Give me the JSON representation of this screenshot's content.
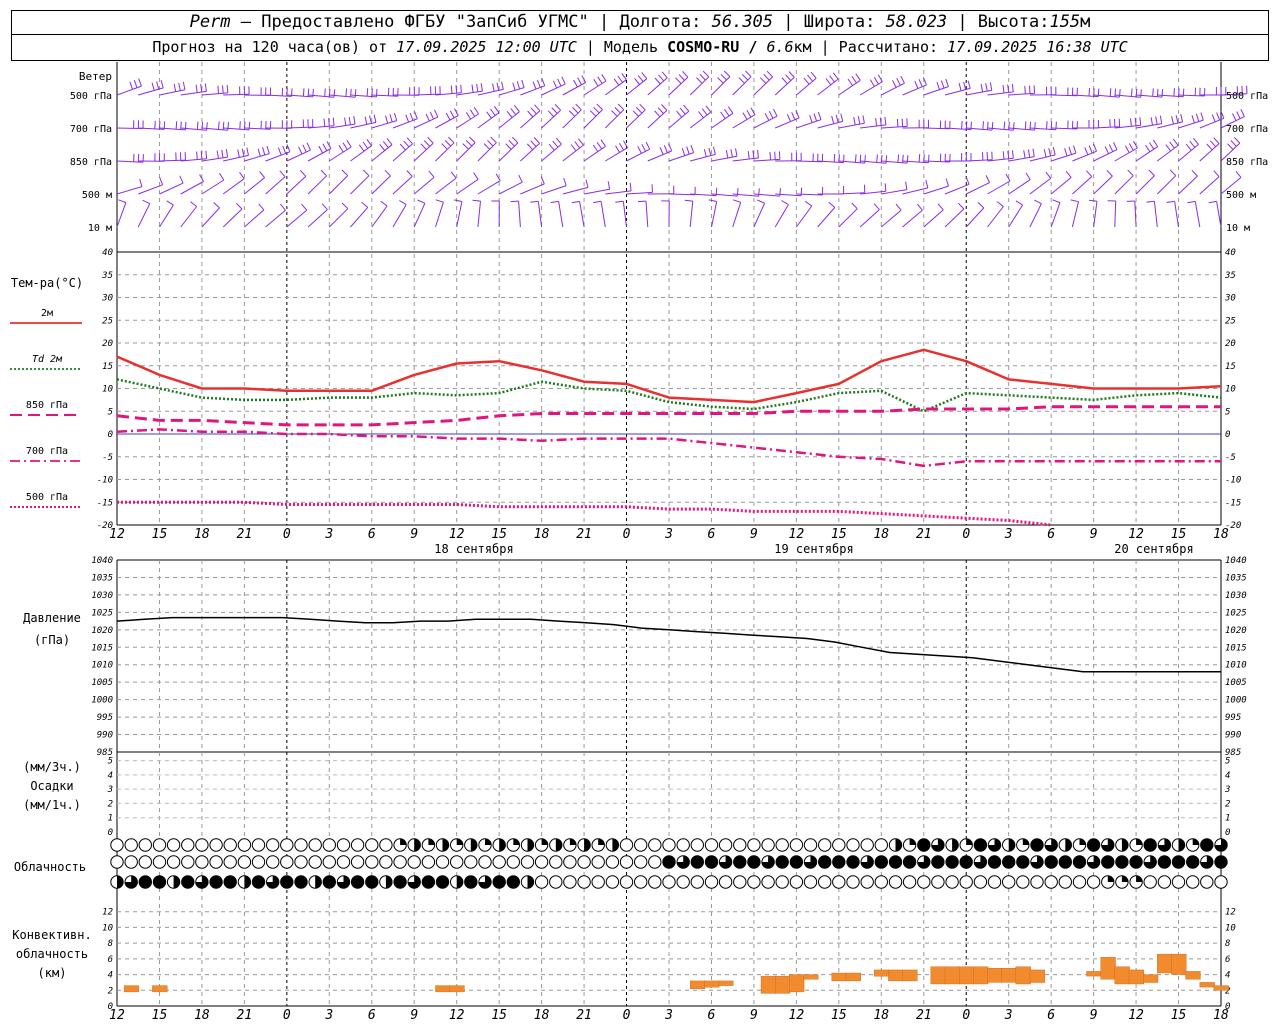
{
  "header": {
    "line1": {
      "station": "Perm",
      "provider": "— Предоставлено ФГБУ \"ЗапСиб УГМС\" | Долгота:",
      "lon": "56.305",
      "lat_label": "| Широта:",
      "lat": "58.023",
      "alt_label": "| Высота:",
      "alt": "155",
      "alt_unit": "м"
    },
    "line2": {
      "prefix": "Прогноз на 120 часа(ов) от",
      "run": "17.09.2025 12:00 UTC",
      "model_label": "| Модель",
      "model": "COSMO-RU /",
      "res": "6.6",
      "res_unit": "км | Рассчитано:",
      "calc": "17.09.2025 16:38 UTC"
    }
  },
  "wind_panel": {
    "title": "Ветер",
    "levels": [
      "500 гПа",
      "700 гПа",
      "850 гПа",
      "500 м",
      "10 м"
    ]
  },
  "temp_panel": {
    "title": "Тем-ра(°C)",
    "legend": [
      {
        "label": "2м",
        "color": "#e8302e",
        "style": "solid"
      },
      {
        "label": "Td 2м",
        "color": "#1f7a1f",
        "style": "dotted"
      },
      {
        "label": "850 гПа",
        "color": "#e0167f",
        "style": "dashed"
      },
      {
        "label": "700 гПа",
        "color": "#e0167f",
        "style": "dashdot"
      },
      {
        "label": "500 гПа",
        "color": "#e0167f",
        "style": "dotted"
      }
    ]
  },
  "press_panel": {
    "title1": "Давление",
    "title2": "(гПа)"
  },
  "precip_panel": {
    "line1": "(мм/3ч.)",
    "line2": "Осадки",
    "line3": "(мм/1ч.)"
  },
  "cloud_panel": {
    "title": "Облачность"
  },
  "conv_panel": {
    "line1": "Конвективн.",
    "line2": "облачность",
    "line3": "(км)"
  },
  "time_labels": [
    "12",
    "15",
    "18",
    "21",
    "0",
    "3",
    "6",
    "9",
    "12",
    "15",
    "18",
    "21",
    "0",
    "3",
    "6",
    "9",
    "12",
    "15",
    "18",
    "21",
    "0",
    "3",
    "6",
    "9",
    "12",
    "15",
    "18"
  ],
  "date_labels": [
    "18 сентября",
    "19 сентября",
    "20 сентября"
  ],
  "colors": {
    "wind": "#8a2be2",
    "t2m": "#e8302e",
    "td": "#1f7a1f",
    "upper": "#e0167f",
    "pressure": "#000000",
    "convective": "#f28a2e",
    "zero_line": "#3b3bd6"
  },
  "chart_data": [
    {
      "type": "line",
      "title": "Тем-ра(°C)",
      "ylim": [
        -20,
        40
      ],
      "yticks": [
        -20,
        -15,
        -10,
        -5,
        0,
        5,
        10,
        15,
        20,
        25,
        30,
        35,
        40
      ],
      "x_hours": [
        0,
        3,
        6,
        9,
        12,
        15,
        18,
        21,
        24,
        27,
        30,
        33,
        36,
        39,
        42,
        45,
        48,
        51,
        54,
        57,
        60,
        63,
        66,
        69,
        72,
        75,
        78
      ],
      "series": [
        {
          "name": "2м",
          "values": [
            17,
            13,
            10,
            10,
            9.5,
            9.5,
            9.5,
            13,
            15.5,
            16,
            14,
            11.5,
            11,
            8,
            7.5,
            7,
            9,
            11,
            16,
            18.5,
            16,
            12,
            11,
            10,
            10,
            10,
            10.5
          ]
        },
        {
          "name": "Td 2м",
          "values": [
            12,
            10,
            8,
            7.5,
            7.5,
            8,
            8,
            9,
            8.5,
            9,
            11.5,
            10,
            9.5,
            7,
            6,
            5.5,
            7,
            9,
            9.5,
            5,
            9,
            8.5,
            8,
            7.5,
            8.5,
            9,
            8
          ]
        },
        {
          "name": "850 гПа",
          "values": [
            4,
            3,
            3,
            2.5,
            2,
            2,
            2,
            2.5,
            3,
            4,
            4.5,
            4.5,
            4.5,
            4.5,
            4.5,
            4.5,
            5,
            5,
            5,
            5.5,
            5.5,
            5.5,
            6,
            6,
            6,
            6,
            6
          ]
        },
        {
          "name": "700 гПа",
          "values": [
            0.5,
            1,
            0.5,
            0.5,
            0,
            0,
            -0.5,
            -0.5,
            -1,
            -1,
            -1.5,
            -1,
            -1,
            -1,
            -2,
            -3,
            -4,
            -5,
            -5.5,
            -7,
            -6,
            -6,
            -6,
            -6,
            -6,
            -6,
            -6
          ]
        },
        {
          "name": "500 гПа",
          "values": [
            -15,
            -15,
            -15,
            -15,
            -15.5,
            -15.5,
            -15.5,
            -15.5,
            -15.5,
            -16,
            -16,
            -16,
            -16,
            -16.5,
            -16.5,
            -17,
            -17,
            -17,
            -17.5,
            -18,
            -18.5,
            -19,
            -20
          ]
        }
      ]
    },
    {
      "type": "line",
      "title": "Давление (гПа)",
      "ylim": [
        985,
        1040
      ],
      "yticks": [
        985,
        990,
        995,
        1000,
        1005,
        1010,
        1015,
        1020,
        1025,
        1030,
        1035,
        1040
      ],
      "series": [
        {
          "values": [
            1022.5,
            1023,
            1023.5,
            1023.5,
            1023.5,
            1023.5,
            1023.5,
            1023,
            1022.5,
            1022,
            1022,
            1022.5,
            1022.5,
            1023,
            1023,
            1023,
            1022.5,
            1022,
            1021.5,
            1020.5,
            1020,
            1019.5,
            1019,
            1018.5,
            1018,
            1017.5,
            1016.5,
            1015,
            1013.5,
            1013,
            1012.5,
            1012,
            1011,
            1010,
            1009,
            1008,
            1008,
            1008,
            1008,
            1008,
            1008
          ]
        }
      ]
    },
    {
      "type": "bar",
      "title": "Конвективн. облачность (км)",
      "ylim": [
        0,
        14
      ],
      "yticks": [
        0,
        2,
        4,
        6,
        8,
        10,
        12
      ],
      "bars": [
        {
          "hour": 1,
          "base": 1.8,
          "top": 2.6
        },
        {
          "hour": 3,
          "base": 1.8,
          "top": 2.6
        },
        {
          "hour": 23,
          "base": 1.8,
          "top": 2.6
        },
        {
          "hour": 24,
          "base": 1.8,
          "top": 2.6
        },
        {
          "hour": 41,
          "base": 2.2,
          "top": 3.2
        },
        {
          "hour": 42,
          "base": 2.4,
          "top": 3.2
        },
        {
          "hour": 43,
          "base": 2.6,
          "top": 3.2
        },
        {
          "hour": 46,
          "base": 1.6,
          "top": 3.8
        },
        {
          "hour": 47,
          "base": 1.6,
          "top": 3.8
        },
        {
          "hour": 48,
          "base": 1.8,
          "top": 4.0
        },
        {
          "hour": 49,
          "base": 3.4,
          "top": 4.0
        },
        {
          "hour": 51,
          "base": 3.2,
          "top": 4.2
        },
        {
          "hour": 52,
          "base": 3.2,
          "top": 4.2
        },
        {
          "hour": 54,
          "base": 3.8,
          "top": 4.6
        },
        {
          "hour": 55,
          "base": 3.2,
          "top": 4.6
        },
        {
          "hour": 56,
          "base": 3.2,
          "top": 4.6
        },
        {
          "hour": 58,
          "base": 2.8,
          "top": 5.0
        },
        {
          "hour": 59,
          "base": 2.8,
          "top": 5.0
        },
        {
          "hour": 60,
          "base": 2.8,
          "top": 5.0
        },
        {
          "hour": 61,
          "base": 2.8,
          "top": 5.0
        },
        {
          "hour": 62,
          "base": 3.0,
          "top": 4.8
        },
        {
          "hour": 63,
          "base": 3.0,
          "top": 4.8
        },
        {
          "hour": 64,
          "base": 2.8,
          "top": 5.0
        },
        {
          "hour": 65,
          "base": 3.0,
          "top": 4.6
        },
        {
          "hour": 69,
          "base": 3.8,
          "top": 4.4
        },
        {
          "hour": 70,
          "base": 3.4,
          "top": 6.2
        },
        {
          "hour": 71,
          "base": 2.8,
          "top": 5.0
        },
        {
          "hour": 72,
          "base": 2.8,
          "top": 4.6
        },
        {
          "hour": 73,
          "base": 3.0,
          "top": 4.0
        },
        {
          "hour": 74,
          "base": 4.2,
          "top": 6.6
        },
        {
          "hour": 75,
          "base": 4.0,
          "top": 6.6
        },
        {
          "hour": 76,
          "base": 3.4,
          "top": 4.4
        },
        {
          "hour": 77,
          "base": 2.4,
          "top": 3.0
        },
        {
          "hour": 78,
          "base": 2.0,
          "top": 2.6
        }
      ]
    }
  ]
}
